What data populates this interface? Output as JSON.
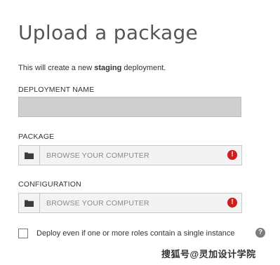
{
  "title": "Upload a package",
  "intro": {
    "prefix": "This will create a new ",
    "emphasis": "staging",
    "suffix": " deployment."
  },
  "deployment_name": {
    "label": "DEPLOYMENT NAME",
    "value": ""
  },
  "package": {
    "label": "PACKAGE",
    "placeholder": "BROWSE YOUR COMPUTER",
    "status_icon": "error-icon"
  },
  "configuration": {
    "label": "CONFIGURATION",
    "placeholder": "BROWSE YOUR COMPUTER",
    "status_icon": "error-icon"
  },
  "option": {
    "checked": false,
    "label": "Deploy even if one or more roles contain a single instance",
    "help_icon": "help-icon"
  },
  "watermark": "搜狐号@灵加设计学院",
  "colors": {
    "error": "#d31b1b",
    "field_bg": "#f3f3f3",
    "disabled_field_bg": "#cfcfcf"
  }
}
